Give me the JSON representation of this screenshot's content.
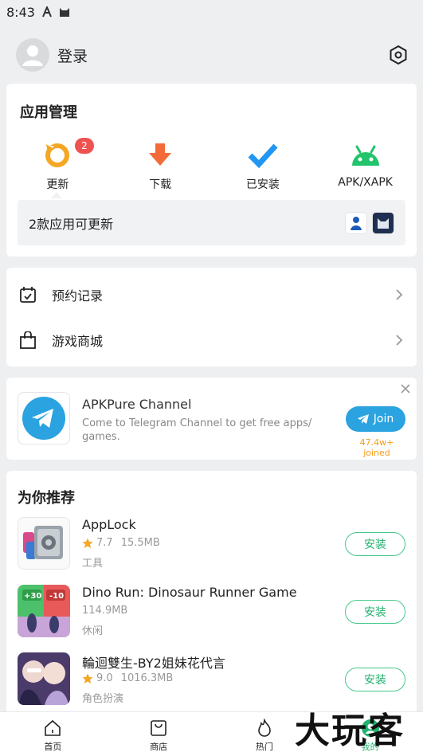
{
  "status_bar": {
    "time": "8:43"
  },
  "header": {
    "login_label": "登录"
  },
  "app_management": {
    "title": "应用管理",
    "items": [
      {
        "label": "更新",
        "icon": "update-icon",
        "badge": "2"
      },
      {
        "label": "下载",
        "icon": "download-icon"
      },
      {
        "label": "已安装",
        "icon": "installed-check-icon"
      },
      {
        "label": "APK/XAPK",
        "icon": "android-icon"
      }
    ],
    "update_summary": "2款应用可更新"
  },
  "menu": {
    "items": [
      {
        "label": "预约记录",
        "icon": "calendar-check-icon"
      },
      {
        "label": "游戏商城",
        "icon": "shopping-bag-icon"
      }
    ]
  },
  "telegram_promo": {
    "name": "APKPure Channel",
    "description": "Come to Telegram Channel to get free apps/ games.",
    "join_label": "Join",
    "joined_count": "47.4w+ joined",
    "accent": "#2aa3e0"
  },
  "recommendations": {
    "title": "为你推荐",
    "install_label": "安装",
    "apps": [
      {
        "name": "AppLock",
        "rating": "7.7",
        "size": "15.5MB",
        "category": "工具"
      },
      {
        "name": "Dino Run: Dinosaur Runner Game",
        "size": "114.9MB",
        "category": "休闲"
      },
      {
        "name": "輪迴雙生-BY2姐妹花代言",
        "rating": "9.0",
        "size": "1016.3MB",
        "category": "角色扮演"
      }
    ]
  },
  "bottom_nav": {
    "items": [
      {
        "label": "首页",
        "icon": "home-icon"
      },
      {
        "label": "商店",
        "icon": "store-icon"
      },
      {
        "label": "热门",
        "icon": "flame-icon"
      },
      {
        "label": "我的",
        "icon": "profile-icon",
        "active": true
      }
    ]
  },
  "watermark": "大玩客",
  "colors": {
    "brand_green": "#23b26e",
    "badge_red": "#ef5350",
    "star": "#f5a623"
  }
}
